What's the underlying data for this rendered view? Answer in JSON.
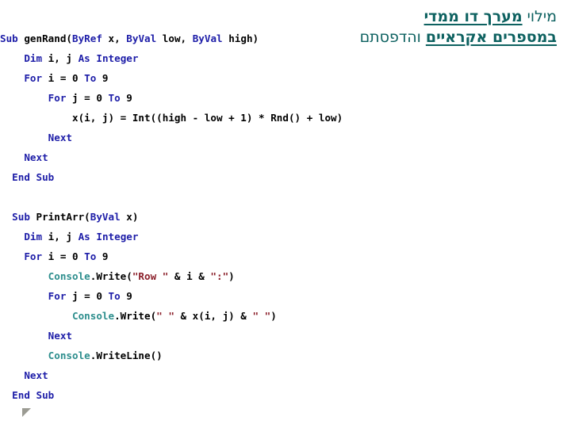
{
  "slide": {
    "background_color": "#ffffff",
    "title": {
      "color": "#0d6160",
      "line1_underlined": "מערך דו ממדי",
      "line1_plain": "מילוי ",
      "line2_underlined": "במספרים אקראיים",
      "line2_plain": " והדפסתם"
    },
    "marker": {
      "name": "triangle-bullet",
      "color": "#9b9b93"
    }
  },
  "code": {
    "language": "Visual Basic",
    "colors": {
      "keyword": "#1d1da8",
      "identifier": "#000000",
      "namespace": "#2d8e8d",
      "string": "#8b1f2a"
    },
    "lines": [
      {
        "indent": 0,
        "tokens": [
          {
            "t": "Sub",
            "c": "kw"
          },
          {
            "t": " ",
            "c": "op"
          },
          {
            "t": "genRand(",
            "c": "id"
          },
          {
            "t": "ByRef",
            "c": "kw"
          },
          {
            "t": " x, ",
            "c": "id"
          },
          {
            "t": "ByVal",
            "c": "kw"
          },
          {
            "t": " low, ",
            "c": "id"
          },
          {
            "t": "ByVal",
            "c": "kw"
          },
          {
            "t": " high)",
            "c": "id"
          }
        ]
      },
      {
        "indent": 1,
        "tokens": [
          {
            "t": "Dim",
            "c": "kw"
          },
          {
            "t": " i, j ",
            "c": "id"
          },
          {
            "t": "As",
            "c": "kw"
          },
          {
            "t": " ",
            "c": "id"
          },
          {
            "t": "Integer",
            "c": "ty"
          }
        ]
      },
      {
        "indent": 1,
        "tokens": [
          {
            "t": "For",
            "c": "kw"
          },
          {
            "t": " i = 0 ",
            "c": "id"
          },
          {
            "t": "To",
            "c": "kw"
          },
          {
            "t": " 9",
            "c": "id"
          }
        ]
      },
      {
        "indent": 2,
        "tokens": [
          {
            "t": "For",
            "c": "kw"
          },
          {
            "t": " j = 0 ",
            "c": "id"
          },
          {
            "t": "To",
            "c": "kw"
          },
          {
            "t": " 9",
            "c": "id"
          }
        ]
      },
      {
        "indent": 3,
        "tokens": [
          {
            "t": "x(i, j) = Int((high - low + 1) * Rnd() + low)",
            "c": "id"
          }
        ]
      },
      {
        "indent": 2,
        "tokens": [
          {
            "t": "Next",
            "c": "kw"
          }
        ]
      },
      {
        "indent": 1,
        "tokens": [
          {
            "t": "Next",
            "c": "kw"
          }
        ]
      },
      {
        "indent": 0.5,
        "tokens": [
          {
            "t": "End",
            "c": "kw"
          },
          {
            "t": " ",
            "c": "id"
          },
          {
            "t": "Sub",
            "c": "kw"
          }
        ]
      },
      {
        "indent": 0,
        "blank": true,
        "tokens": []
      },
      {
        "indent": 0.5,
        "tokens": [
          {
            "t": "Sub",
            "c": "kw"
          },
          {
            "t": " ",
            "c": "op"
          },
          {
            "t": "PrintArr(",
            "c": "id"
          },
          {
            "t": "ByVal",
            "c": "kw"
          },
          {
            "t": " x)",
            "c": "id"
          }
        ]
      },
      {
        "indent": 1,
        "tokens": [
          {
            "t": "Dim",
            "c": "kw"
          },
          {
            "t": " i, j ",
            "c": "id"
          },
          {
            "t": "As",
            "c": "kw"
          },
          {
            "t": " ",
            "c": "id"
          },
          {
            "t": "Integer",
            "c": "ty"
          }
        ]
      },
      {
        "indent": 1,
        "tokens": [
          {
            "t": "For",
            "c": "kw"
          },
          {
            "t": " i = 0 ",
            "c": "id"
          },
          {
            "t": "To",
            "c": "kw"
          },
          {
            "t": " 9",
            "c": "id"
          }
        ]
      },
      {
        "indent": 2,
        "tokens": [
          {
            "t": "Console",
            "c": "ns"
          },
          {
            "t": ".Write(",
            "c": "id"
          },
          {
            "t": "\"Row \"",
            "c": "st"
          },
          {
            "t": " & i & ",
            "c": "id"
          },
          {
            "t": "\":\"",
            "c": "st"
          },
          {
            "t": ")",
            "c": "id"
          }
        ]
      },
      {
        "indent": 2,
        "tokens": [
          {
            "t": "For",
            "c": "kw"
          },
          {
            "t": " j = 0 ",
            "c": "id"
          },
          {
            "t": "To",
            "c": "kw"
          },
          {
            "t": " 9",
            "c": "id"
          }
        ]
      },
      {
        "indent": 3,
        "tokens": [
          {
            "t": "Console",
            "c": "ns"
          },
          {
            "t": ".Write(",
            "c": "id"
          },
          {
            "t": "\" \"",
            "c": "st"
          },
          {
            "t": " & x(i, j) & ",
            "c": "id"
          },
          {
            "t": "\" \"",
            "c": "st"
          },
          {
            "t": ")",
            "c": "id"
          }
        ]
      },
      {
        "indent": 2,
        "tokens": [
          {
            "t": "Next",
            "c": "kw"
          }
        ]
      },
      {
        "indent": 2,
        "tokens": [
          {
            "t": "Console",
            "c": "ns"
          },
          {
            "t": ".WriteLine()",
            "c": "id"
          }
        ]
      },
      {
        "indent": 1,
        "tokens": [
          {
            "t": "Next",
            "c": "kw"
          }
        ]
      },
      {
        "indent": 0.5,
        "tokens": [
          {
            "t": "End",
            "c": "kw"
          },
          {
            "t": " ",
            "c": "id"
          },
          {
            "t": "Sub",
            "c": "kw"
          }
        ]
      }
    ]
  }
}
